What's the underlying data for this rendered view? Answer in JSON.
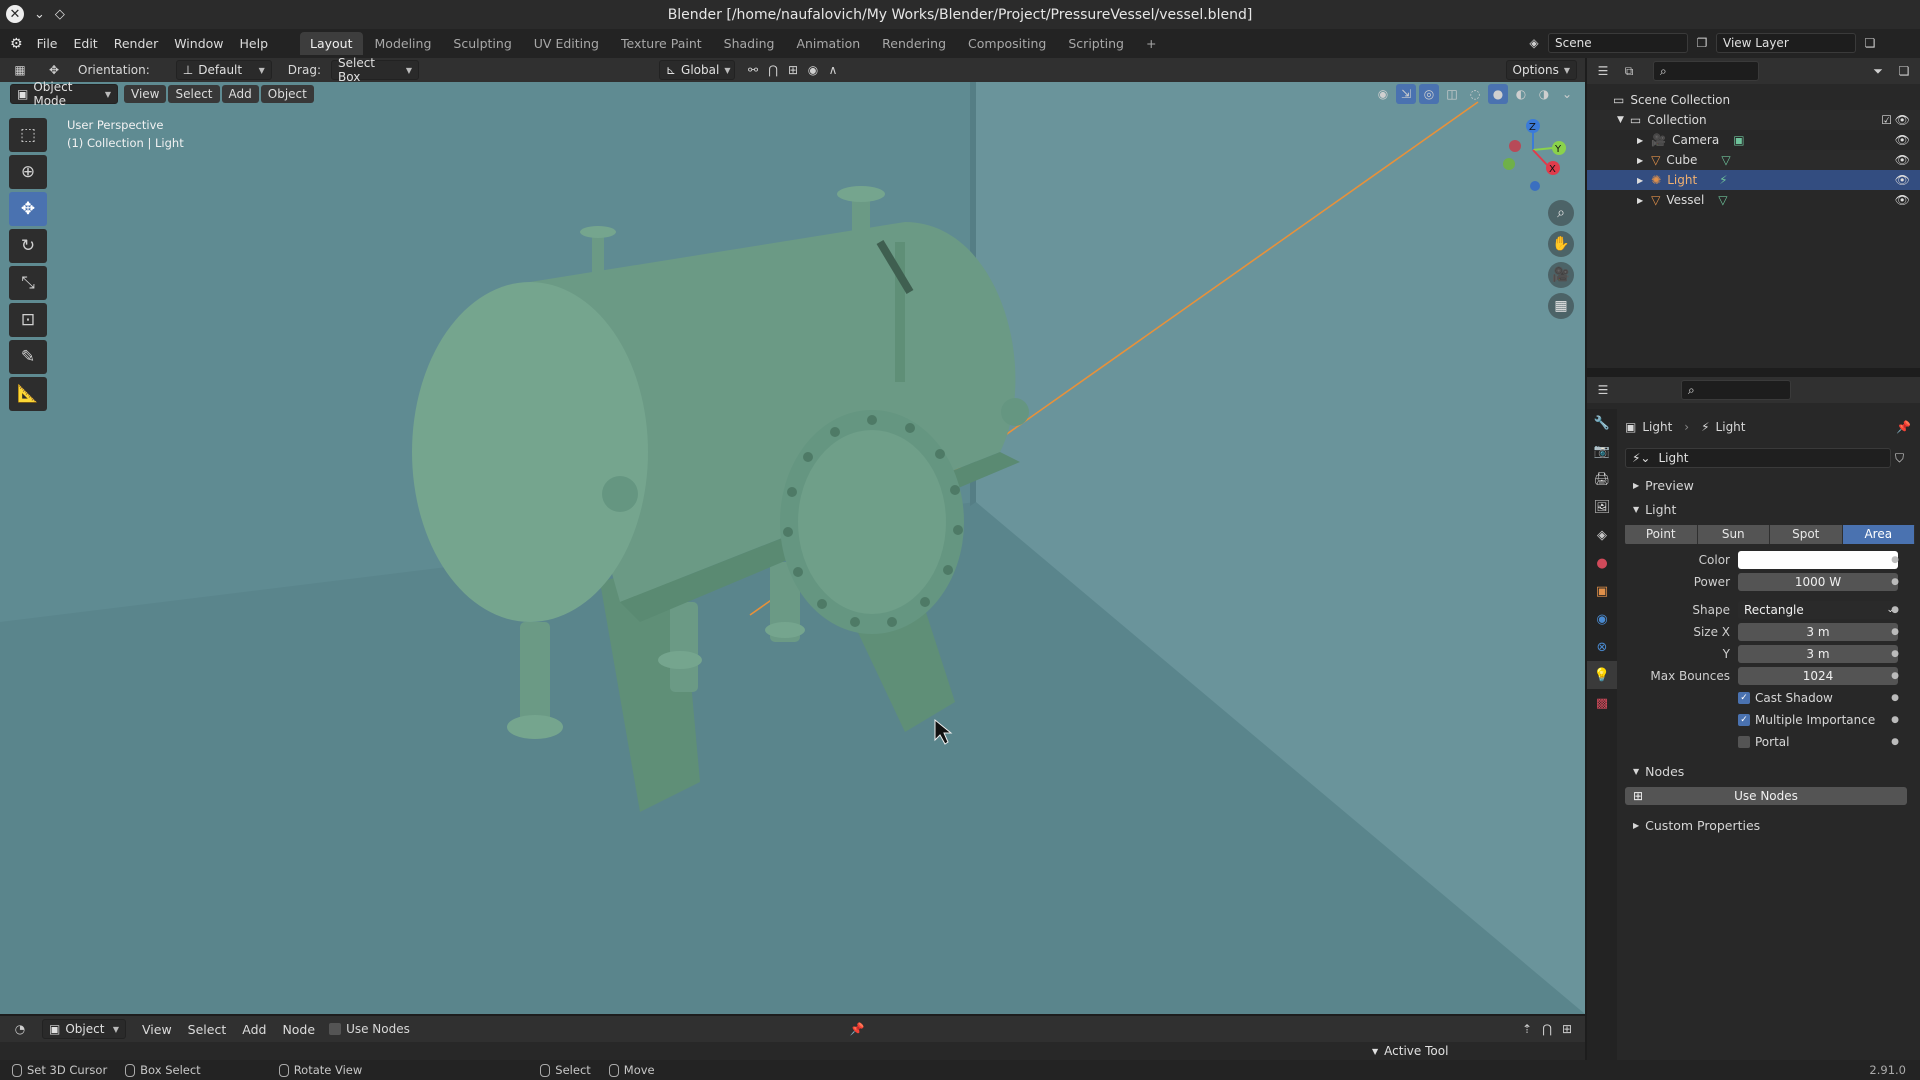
{
  "titlebar": {
    "title": "Blender [/home/naufalovich/My Works/Blender/Project/PressureVessel/vessel.blend]"
  },
  "menu": {
    "items": [
      "File",
      "Edit",
      "Render",
      "Window",
      "Help"
    ]
  },
  "workspaces": {
    "tabs": [
      "Layout",
      "Modeling",
      "Sculpting",
      "UV Editing",
      "Texture Paint",
      "Shading",
      "Animation",
      "Rendering",
      "Compositing",
      "Scripting"
    ],
    "add": "+"
  },
  "scene": {
    "label": "Scene",
    "view_layer": "View Layer"
  },
  "tool_header": {
    "orientation_label": "Orientation:",
    "orientation_value": "Default",
    "drag_label": "Drag:",
    "drag_value": "Select Box",
    "transform": "Global",
    "options": "Options"
  },
  "viewport_header": {
    "mode": "Object Mode",
    "menus": [
      "View",
      "Select",
      "Add",
      "Object"
    ]
  },
  "viewport": {
    "perspective": "User Perspective",
    "context": "(1) Collection | Light",
    "gizmo": {
      "z": "Z",
      "y": "Y",
      "x": "X"
    }
  },
  "outliner": {
    "root": "Scene Collection",
    "collection": "Collection",
    "items": [
      {
        "name": "Camera",
        "icon": "camera-icon"
      },
      {
        "name": "Cube",
        "icon": "mesh-icon"
      },
      {
        "name": "Light",
        "icon": "light-icon"
      },
      {
        "name": "Vessel",
        "icon": "mesh-icon"
      }
    ]
  },
  "properties": {
    "breadcrumb_obj": "Light",
    "breadcrumb_data": "Light",
    "datablock": "Light",
    "panels": {
      "preview": "Preview",
      "light": "Light",
      "nodes": "Nodes",
      "custom": "Custom Properties"
    },
    "light_types": [
      "Point",
      "Sun",
      "Spot",
      "Area"
    ],
    "selected_type": "Area",
    "color_label": "Color",
    "power_label": "Power",
    "power_value": "1000 W",
    "shape_label": "Shape",
    "shape_value": "Rectangle",
    "sizex_label": "Size X",
    "sizex_value": "3 m",
    "sizey_label": "Y",
    "sizey_value": "3 m",
    "bounces_label": "Max Bounces",
    "bounces_value": "1024",
    "cast_shadow": "Cast Shadow",
    "multiple_importance": "Multiple Importance",
    "portal": "Portal",
    "use_nodes": "Use Nodes"
  },
  "bottom_header": {
    "type": "Object",
    "menus": [
      "View",
      "Select",
      "Add",
      "Node"
    ],
    "use_nodes": "Use Nodes",
    "active_tool": "Active Tool"
  },
  "statusbar": {
    "set_cursor": "Set 3D Cursor",
    "box_select": "Box Select",
    "rotate": "Rotate View",
    "select": "Select",
    "move": "Move",
    "version": "2.91.0"
  },
  "colors": {
    "viewport_bg": "#5f8b92",
    "accent": "#4a72b0",
    "vessel": "#6b9a85",
    "selection_row": "#334d80"
  }
}
